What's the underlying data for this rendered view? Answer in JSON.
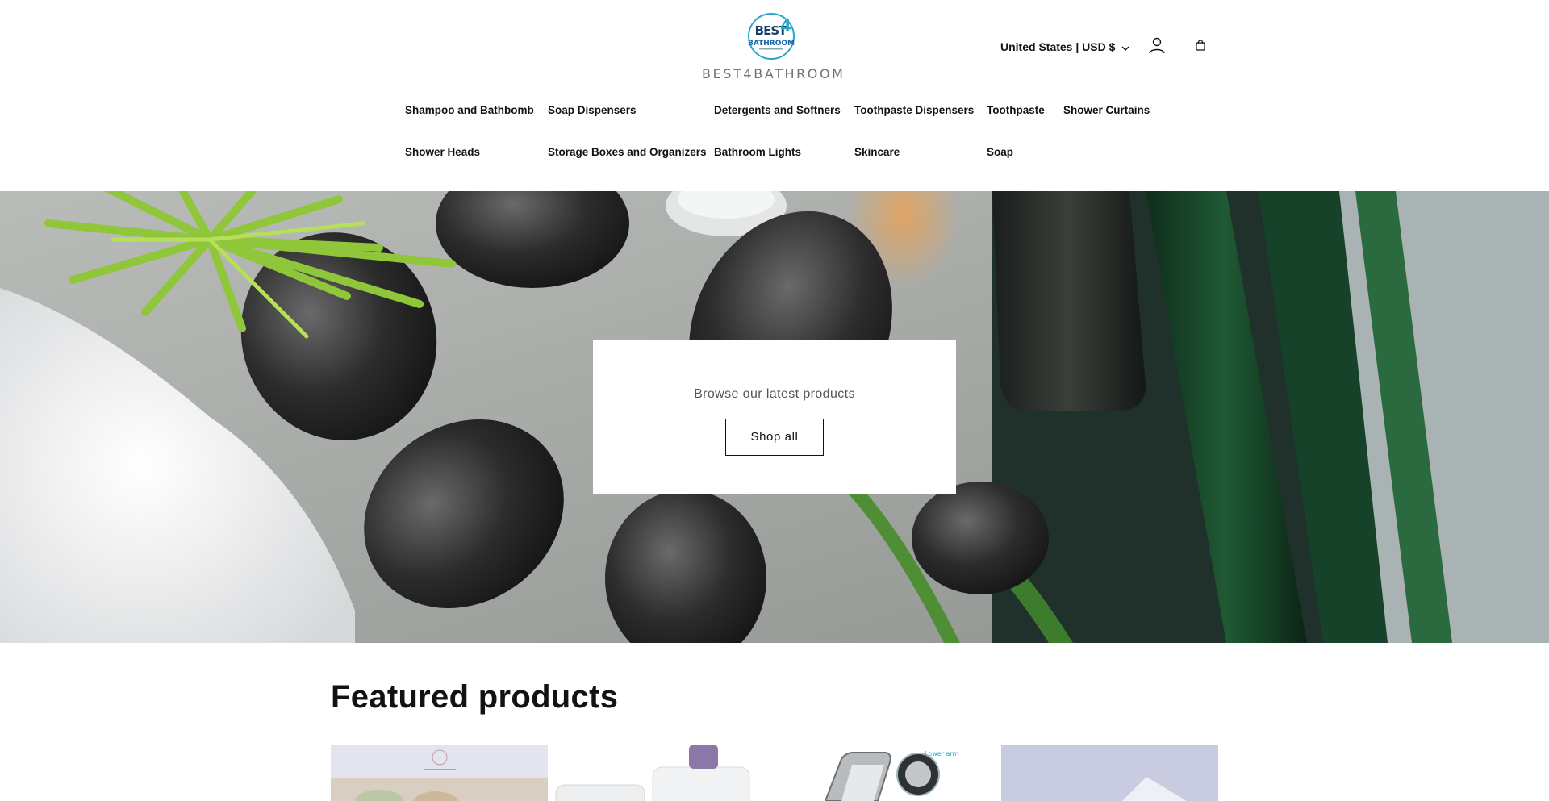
{
  "brand": {
    "logo_top": "BEST4",
    "logo_bottom": "BATHROOM",
    "name": "BEST4BATHROOM"
  },
  "header": {
    "localization": "United States | USD $",
    "account_icon": "user-icon",
    "cart_icon": "bag-icon"
  },
  "nav": {
    "items": [
      "Shampoo and Bathbomb",
      "Soap Dispensers",
      "Detergents and Softners",
      "Toothpaste Dispensers",
      "Toothpaste",
      "Shower Curtains",
      "Shower Heads",
      "Storage Boxes and Organizers",
      "Bathroom Lights",
      "Skincare",
      "Soap"
    ]
  },
  "hero": {
    "text": "Browse our latest products",
    "button": "Shop all"
  },
  "featured": {
    "title": "Featured products"
  },
  "colors": {
    "text": "#121212",
    "logo_blue": "#1565a8",
    "logo_teal": "#2aa8c8",
    "muted": "#707070"
  }
}
